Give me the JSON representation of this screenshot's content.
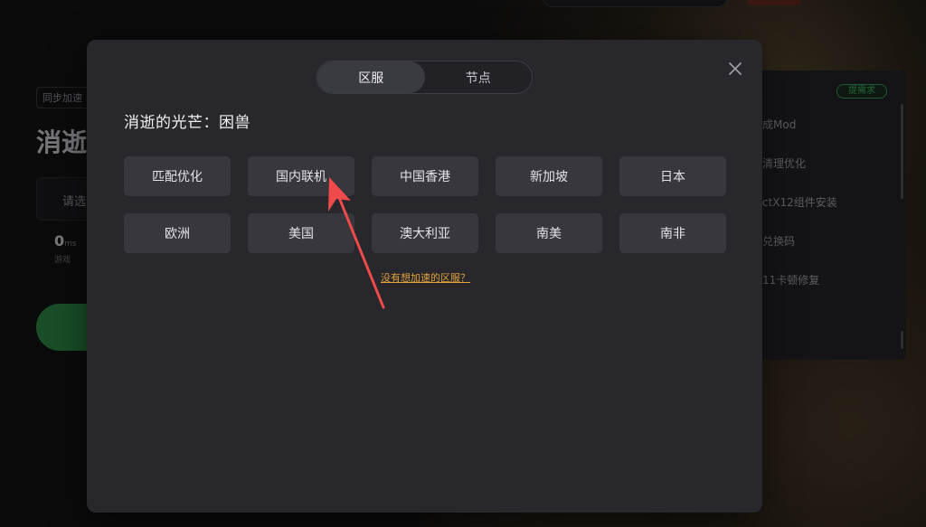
{
  "background": {
    "tag_label": "同步加速",
    "game_title_partial": "消逝",
    "select_placeholder": "请选",
    "latency_value": "0",
    "latency_unit": "ms",
    "latency_sub": "游戏",
    "panel_badge": "提需求",
    "panel_items": [
      "成Mod",
      "清理优化",
      "ctX12组件安装",
      "兑换码",
      "11卡顿修复"
    ]
  },
  "modal": {
    "tabs": [
      {
        "label": "区服",
        "active": true
      },
      {
        "label": "节点",
        "active": false
      }
    ],
    "game_title": "消逝的光芒：困兽",
    "regions": [
      "匹配优化",
      "国内联机",
      "中国香港",
      "新加坡",
      "日本",
      "欧洲",
      "美国",
      "澳大利亚",
      "南美",
      "南非"
    ],
    "missing_region_link": "没有想加速的区服？"
  },
  "colors": {
    "modal_bg": "#27272c",
    "button_bg": "#37373d",
    "link": "#e0a03c",
    "annotation_arrow": "#f04a4a",
    "accent_green": "#3fbf62"
  },
  "icons": {
    "close": "close-icon",
    "annotation": "red-arrow-icon"
  }
}
